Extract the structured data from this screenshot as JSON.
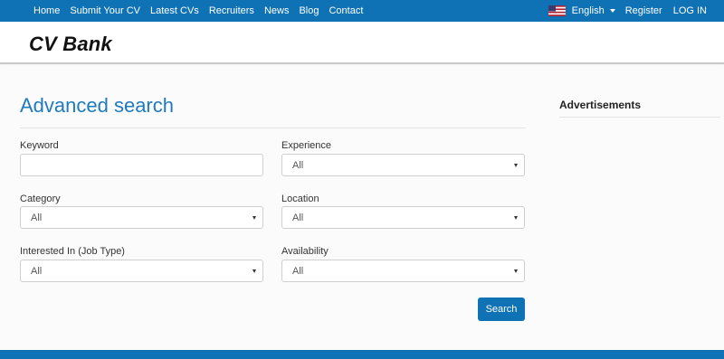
{
  "nav": {
    "links": [
      "Home",
      "Submit Your CV",
      "Latest CVs",
      "Recruiters",
      "News",
      "Blog",
      "Contact"
    ],
    "language": "English",
    "flag_icon": "us-flag-icon",
    "register": "Register",
    "login": "LOG IN"
  },
  "brand": {
    "name": "CV Bank"
  },
  "search": {
    "title": "Advanced search",
    "keyword": {
      "label": "Keyword",
      "value": "",
      "placeholder": ""
    },
    "experience": {
      "label": "Experience",
      "value": "All"
    },
    "category": {
      "label": "Category",
      "value": "All"
    },
    "location": {
      "label": "Location",
      "value": "All"
    },
    "job_type": {
      "label": "Interested In (Job Type)",
      "value": "All"
    },
    "availability": {
      "label": "Availability",
      "value": "All"
    },
    "button": "Search"
  },
  "sidebar": {
    "ads_title": "Advertisements"
  },
  "colors": {
    "primary": "#0f72b4",
    "title": "#1f7bbd"
  }
}
